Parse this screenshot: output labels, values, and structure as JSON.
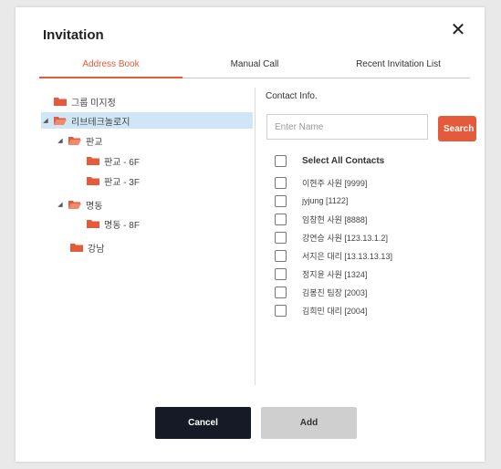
{
  "dialog": {
    "title": "Invitation",
    "close_icon": "close-icon"
  },
  "tabs": [
    {
      "label": "Address Book",
      "active": true
    },
    {
      "label": "Manual Call",
      "active": false
    },
    {
      "label": "Recent Invitation List",
      "active": false
    }
  ],
  "tree": [
    {
      "label": "그룹 미지정",
      "expanded": null,
      "selected": false,
      "level": 0
    },
    {
      "label": "리브테크놀로지",
      "expanded": true,
      "selected": true,
      "level": 0
    },
    {
      "label": "판교",
      "expanded": true,
      "selected": false,
      "level": 1
    },
    {
      "label": "판교 - 6F",
      "expanded": null,
      "selected": false,
      "level": 2
    },
    {
      "label": "판교 - 3F",
      "expanded": null,
      "selected": false,
      "level": 2
    },
    {
      "label": "명동",
      "expanded": true,
      "selected": false,
      "level": 1
    },
    {
      "label": "명동 - 8F",
      "expanded": null,
      "selected": false,
      "level": 2
    },
    {
      "label": "강남",
      "expanded": null,
      "selected": false,
      "level": 1
    }
  ],
  "contact": {
    "title": "Contact Info.",
    "search_placeholder": "Enter Name",
    "search_button": "Search",
    "select_all": "Select All Contacts",
    "items": [
      "이현주 사원 [9999]",
      "jyjung [1122]",
      "임창현 사원 [8888]",
      "강연승 사원 [123.13.1.2]",
      "서지은 대리 [13.13.13.13]",
      "정지윤 사원 [1324]",
      "김봉진 팀장 [2003]",
      "김희민 대리 [2004]"
    ]
  },
  "footer": {
    "cancel": "Cancel",
    "add": "Add"
  },
  "colors": {
    "accent": "#e45a3b",
    "folder": "#e45a3b",
    "cancel_bg": "#161a27",
    "add_bg": "#cfcfcf",
    "selected_row": "#cfe6f7"
  }
}
